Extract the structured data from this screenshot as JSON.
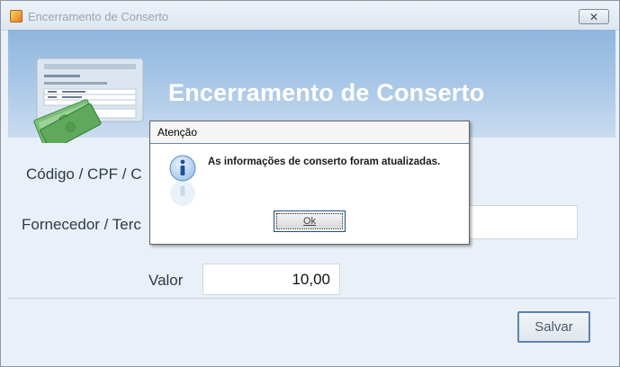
{
  "window": {
    "title": "Encerramento de Conserto",
    "close_label": "✕"
  },
  "header": {
    "title": "Encerramento de Conserto",
    "logo_icon": "invoice-money-icon"
  },
  "form": {
    "codigo_label": "Código / CPF / C",
    "fornecedor_label": "Fornecedor / Terc",
    "valor_label": "Valor",
    "valor_value": "10,00"
  },
  "footer": {
    "save_label": "Salvar"
  },
  "dialog": {
    "title": "Atenção",
    "message": "As informações de conserto foram atualizadas.",
    "ok_label": "Ok",
    "icon": "info-icon"
  }
}
